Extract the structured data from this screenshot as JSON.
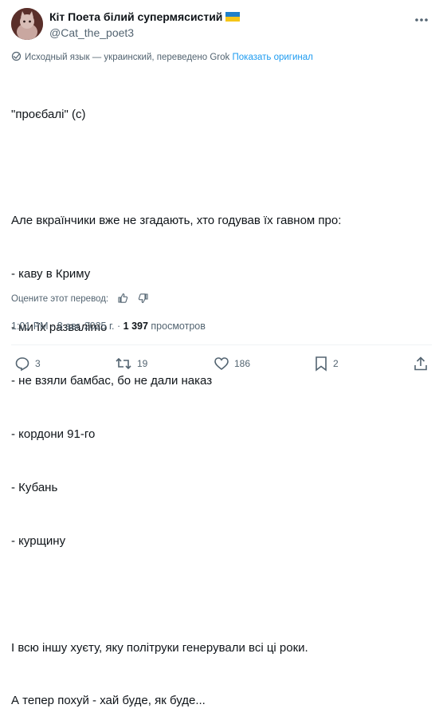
{
  "author": {
    "display_name": "Кіт Поета білий супермясистий",
    "handle": "@Cat_the_poet3",
    "flag_colors": {
      "top": "#1f7fc9",
      "bottom": "#f5c518"
    }
  },
  "translation": {
    "note": "Исходный язык — украинский, переведено Grok",
    "show_original": "Показать оригинал"
  },
  "tweet_lines": [
    "\"проєбалі\" (с)",
    "",
    "Але вкраїнчики вже не згадають, хто годував їх гавном про:",
    "- каву в Криму",
    "- ми їх разваліmo",
    "- не взяли бамбас, бо не дали наказ",
    "- кордони 91-го",
    "- Кубань",
    "- курщину",
    "",
    "І всю іншу хуєту, яку політруки генерували всі ці роки.",
    "А тепер похуй - хай буде, як буде..."
  ],
  "rate_label": "Оцените этот перевод:",
  "meta": {
    "time": "1:01 PM",
    "sep": "·",
    "date": "8 авг. 2025 г.",
    "views_count": "1 397",
    "views_label": "просмотров"
  },
  "actions": {
    "replies": "3",
    "reposts": "19",
    "likes": "186",
    "bookmarks": "2"
  },
  "icons": [
    "more-icon",
    "translate-icon",
    "thumbs-up-icon",
    "thumbs-down-icon",
    "reply-icon",
    "repost-icon",
    "like-icon",
    "bookmark-icon",
    "share-icon"
  ]
}
